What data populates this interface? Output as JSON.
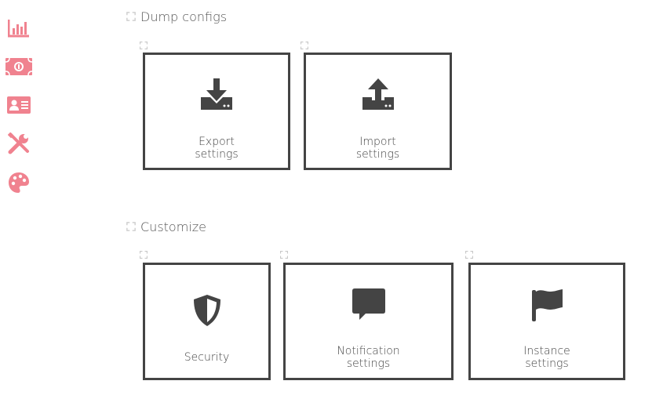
{
  "colors": {
    "accent": "#f0828f",
    "tile_border": "#444444",
    "text": "#444444",
    "mark": "#c8c8c8"
  },
  "sidebar": {
    "items": [
      {
        "icon": "bar-chart-icon"
      },
      {
        "icon": "money-bill-icon"
      },
      {
        "icon": "id-card-icon"
      },
      {
        "icon": "tools-icon"
      },
      {
        "icon": "palette-icon"
      }
    ]
  },
  "sections": {
    "dump": {
      "title": "Dump configs",
      "tiles": [
        {
          "label": "Export\nsettings",
          "icon": "download-icon"
        },
        {
          "label": "Import\nsettings",
          "icon": "upload-icon"
        }
      ]
    },
    "customize": {
      "title": "Customize",
      "tiles": [
        {
          "label": "Security",
          "icon": "shield-icon"
        },
        {
          "label": "Notification\nsettings",
          "icon": "comment-icon"
        },
        {
          "label": "Instance\nsettings",
          "icon": "flag-icon"
        }
      ]
    }
  }
}
